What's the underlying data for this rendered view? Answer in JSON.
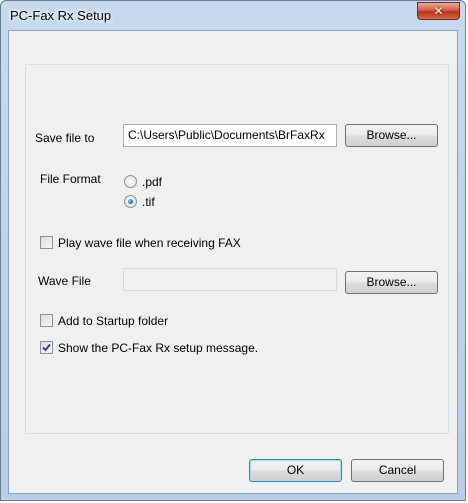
{
  "window": {
    "title": "PC-Fax Rx Setup",
    "close_glyph": "✕"
  },
  "save_file": {
    "label": "Save file to",
    "path_value": "C:\\Users\\Public\\Documents\\BrFaxRx",
    "browse_label": "Browse..."
  },
  "file_format": {
    "label": "File Format",
    "options": [
      {
        "label": ".pdf",
        "selected": false
      },
      {
        "label": ".tif",
        "selected": true
      }
    ]
  },
  "play_wave": {
    "label": "Play wave file when receiving FAX",
    "checked": false
  },
  "wave_file": {
    "label": "Wave File",
    "value": "",
    "browse_label": "Browse..."
  },
  "startup": {
    "label": "Add to Startup folder",
    "checked": false
  },
  "show_setup": {
    "label": "Show the PC-Fax Rx setup message.",
    "checked": true
  },
  "footer": {
    "ok_label": "OK",
    "cancel_label": "Cancel"
  }
}
